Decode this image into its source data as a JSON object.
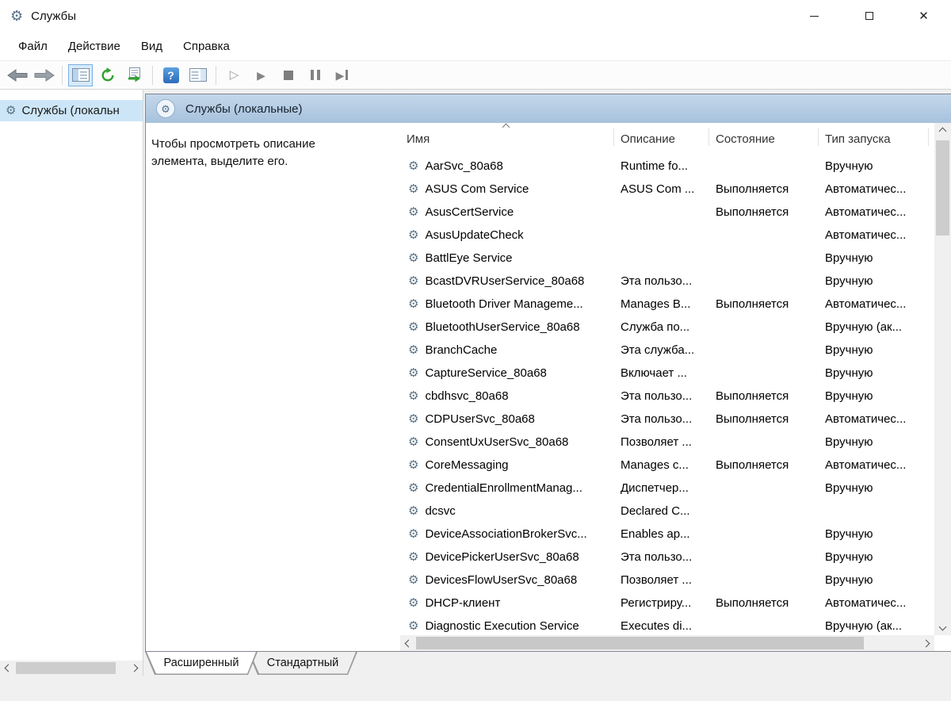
{
  "window": {
    "title": "Службы"
  },
  "menu": {
    "items": [
      "Файл",
      "Действие",
      "Вид",
      "Справка"
    ]
  },
  "toolbar": {
    "buttons": [
      "back",
      "forward",
      "show-console-tree",
      "refresh",
      "export-list",
      "help",
      "show-action-pane",
      "start-service",
      "resume-service",
      "stop-service",
      "pause-service",
      "restart-service"
    ],
    "pressed": "show-console-tree"
  },
  "tree": {
    "root_label": "Службы (локальн"
  },
  "main": {
    "header_title": "Службы (локальные)",
    "description_hint": "Чтобы просмотреть описание элемента, выделите его.",
    "columns": [
      "Имя",
      "Описание",
      "Состояние",
      "Тип запуска"
    ],
    "sort": {
      "column": "Имя",
      "direction": "ascending"
    },
    "rows": [
      {
        "name": "AarSvc_80a68",
        "description": "Runtime fo...",
        "status": "",
        "startup": "Вручную"
      },
      {
        "name": "ASUS Com Service",
        "description": "ASUS Com ...",
        "status": "Выполняется",
        "startup": "Автоматичес..."
      },
      {
        "name": "AsusCertService",
        "description": "",
        "status": "Выполняется",
        "startup": "Автоматичес..."
      },
      {
        "name": "AsusUpdateCheck",
        "description": "",
        "status": "",
        "startup": "Автоматичес..."
      },
      {
        "name": "BattlEye Service",
        "description": "",
        "status": "",
        "startup": "Вручную"
      },
      {
        "name": "BcastDVRUserService_80a68",
        "description": "Эта пользо...",
        "status": "",
        "startup": "Вручную"
      },
      {
        "name": "Bluetooth Driver Manageme...",
        "description": "Manages B...",
        "status": "Выполняется",
        "startup": "Автоматичес..."
      },
      {
        "name": "BluetoothUserService_80a68",
        "description": "Служба по...",
        "status": "",
        "startup": "Вручную (ак..."
      },
      {
        "name": "BranchCache",
        "description": "Эта служба...",
        "status": "",
        "startup": "Вручную"
      },
      {
        "name": "CaptureService_80a68",
        "description": "Включает ...",
        "status": "",
        "startup": "Вручную"
      },
      {
        "name": "cbdhsvc_80a68",
        "description": "Эта пользо...",
        "status": "Выполняется",
        "startup": "Вручную"
      },
      {
        "name": "CDPUserSvc_80a68",
        "description": "Эта пользо...",
        "status": "Выполняется",
        "startup": "Автоматичес..."
      },
      {
        "name": "ConsentUxUserSvc_80a68",
        "description": "Позволяет ...",
        "status": "",
        "startup": "Вручную"
      },
      {
        "name": "CoreMessaging",
        "description": "Manages c...",
        "status": "Выполняется",
        "startup": "Автоматичес..."
      },
      {
        "name": "CredentialEnrollmentManag...",
        "description": "Диспетчер...",
        "status": "",
        "startup": "Вручную"
      },
      {
        "name": "dcsvc",
        "description": "Declared C...",
        "status": "",
        "startup": ""
      },
      {
        "name": "DeviceAssociationBrokerSvc...",
        "description": "Enables ap...",
        "status": "",
        "startup": "Вручную"
      },
      {
        "name": "DevicePickerUserSvc_80a68",
        "description": "Эта пользо...",
        "status": "",
        "startup": "Вручную"
      },
      {
        "name": "DevicesFlowUserSvc_80a68",
        "description": "Позволяет ...",
        "status": "",
        "startup": "Вручную"
      },
      {
        "name": "DHCP-клиент",
        "description": "Регистриру...",
        "status": "Выполняется",
        "startup": "Автоматичес..."
      },
      {
        "name": "Diagnostic Execution Service",
        "description": "Executes di...",
        "status": "",
        "startup": "Вручную (ак..."
      }
    ]
  },
  "tabs": {
    "items": [
      "Расширенный",
      "Стандартный"
    ],
    "active": "Расширенный"
  },
  "colors": {
    "header_band_top": "#c4d7ea",
    "header_band_bottom": "#a7c2dd",
    "tree_selection": "#cde6f7",
    "panel_border": "#828790",
    "toolbar_pressed_border": "#7ab0e0"
  }
}
